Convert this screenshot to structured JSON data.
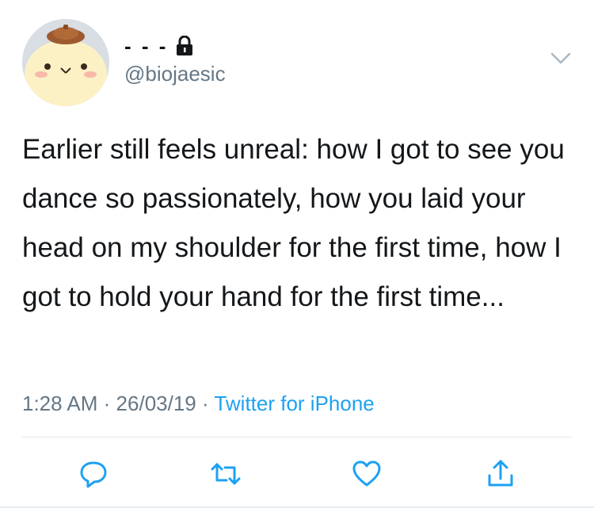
{
  "tweet": {
    "display_name": "- - -",
    "protected": true,
    "handle": "@biojaesic",
    "text": "Earlier still feels unreal: how I got to see you dance so passionately, how you laid your head on my shoulder for the first time, how I got to hold your hand for the first time...",
    "time": "1:28 AM",
    "separator": "·",
    "date": "26/03/19",
    "source": "Twitter for iPhone"
  },
  "icons": {
    "lock": "lock-icon",
    "chevron": "chevron-down-icon",
    "reply": "reply-icon",
    "retweet": "retweet-icon",
    "like": "heart-icon",
    "share": "share-icon"
  },
  "colors": {
    "text": "#14171a",
    "secondary": "#657786",
    "link": "#1da1f2",
    "icon": "#1da1f2",
    "divider": "#e1e8ed"
  }
}
